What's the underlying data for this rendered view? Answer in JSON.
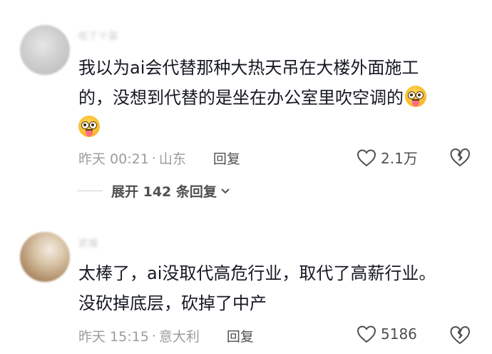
{
  "comments": [
    {
      "username": "吃了个菜",
      "lines": [
        "我以为ai会代替那种大热天吊在大楼外面施工",
        "的，没想到代替的是坐在办公室里吹空调的"
      ],
      "emoji_icon": "drooling-dizzy-face-emoji",
      "time": "昨天 00:21",
      "location": "山东",
      "reply_label": "回复",
      "likes": "2.1万"
    },
    {
      "username": "武城",
      "lines": [
        "太棒了，ai没取代高危行业，取代了高薪行业。",
        "没砍掉底层，砍掉了中产"
      ],
      "time": "昨天 15:15",
      "location": "意大利",
      "reply_label": "回复",
      "likes": "5186"
    }
  ],
  "expand_replies": {
    "label": "展开 142 条回复"
  },
  "separator": "·",
  "icons": {
    "like": "heart-outline-icon",
    "dislike": "broken-heart-icon",
    "expand": "chevron-down-icon"
  }
}
